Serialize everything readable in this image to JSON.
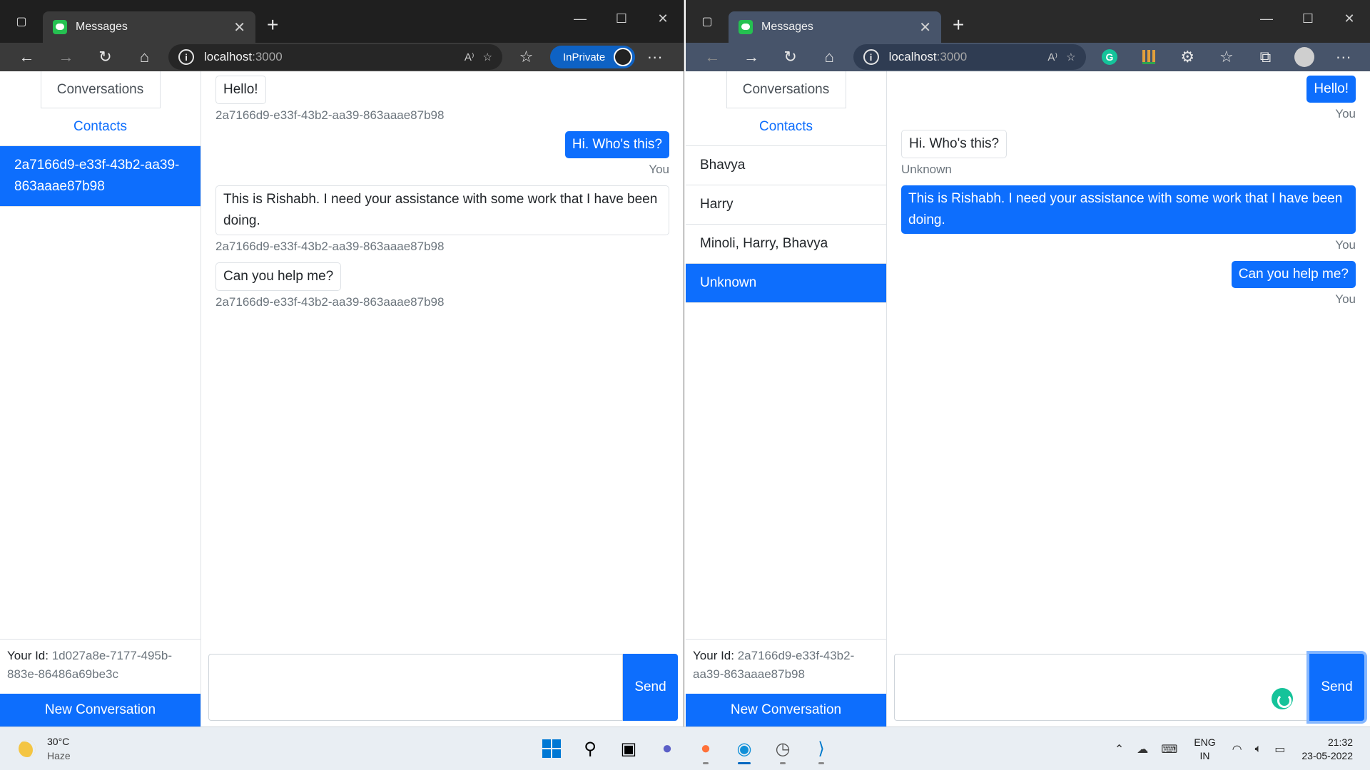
{
  "left_window": {
    "tab_title": "Messages",
    "url_host": "localhost",
    "url_port": ":3000",
    "inprivate_label": "InPrivate",
    "nav": {
      "conversations": "Conversations",
      "contacts": "Contacts"
    },
    "contacts": [
      {
        "label": "2a7166d9-e33f-43b2-aa39-863aaae87b98",
        "active": true
      }
    ],
    "messages": [
      {
        "text": "Hello!",
        "sender": "2a7166d9-e33f-43b2-aa39-863aaae87b98"
      },
      {
        "text": "Hi. Who's this?",
        "sender": "You"
      },
      {
        "text": "This is Rishabh. I need your assistance with some work that I have been doing.",
        "sender": "2a7166d9-e33f-43b2-aa39-863aaae87b98"
      },
      {
        "text": "Can you help me?",
        "sender": "2a7166d9-e33f-43b2-aa39-863aaae87b98"
      }
    ],
    "your_id_label": "Your Id:",
    "your_id": "1d027a8e-7177-495b-883e-86486a69be3c",
    "new_conversation": "New Conversation",
    "send": "Send"
  },
  "right_window": {
    "tab_title": "Messages",
    "url_host": "localhost",
    "url_port": ":3000",
    "nav": {
      "conversations": "Conversations",
      "contacts": "Contacts"
    },
    "contacts": [
      {
        "label": "Bhavya"
      },
      {
        "label": "Harry"
      },
      {
        "label": "Minoli, Harry, Bhavya"
      },
      {
        "label": "Unknown"
      }
    ],
    "messages": [
      {
        "text": "Hello!",
        "sender": "You"
      },
      {
        "text": "Hi. Who's this?",
        "sender": "Unknown"
      },
      {
        "text": "This is Rishabh. I need your assistance with some work that I have been doing.",
        "sender": "You"
      },
      {
        "text": "Can you help me?",
        "sender": "You"
      }
    ],
    "your_id_label": "Your Id:",
    "your_id": "2a7166d9-e33f-43b2-aa39-863aaae87b98",
    "new_conversation": "New Conversation",
    "send": "Send"
  },
  "taskbar": {
    "temperature": "30°C",
    "condition": "Haze",
    "lang_top": "ENG",
    "lang_bottom": "IN",
    "time": "21:32",
    "date": "23-05-2022"
  },
  "colors": {
    "primary": "#0d6efd",
    "muted": "#6c757d",
    "border": "#dee2e6"
  }
}
